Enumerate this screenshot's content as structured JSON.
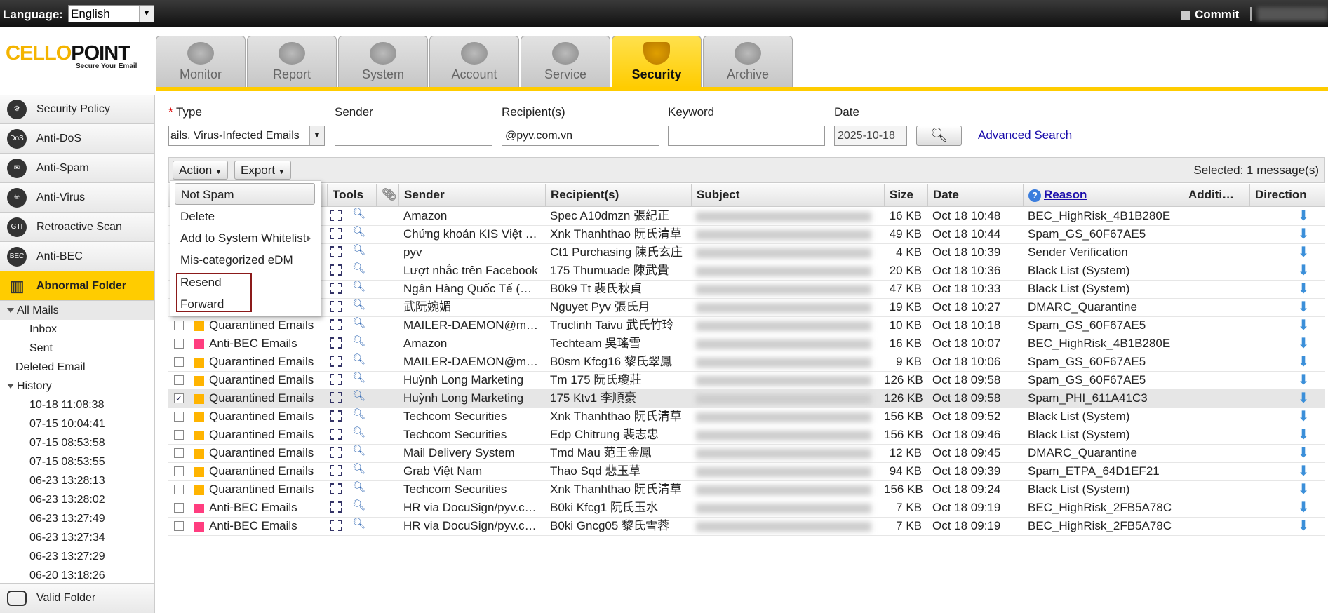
{
  "topbar": {
    "language_label": "Language:",
    "language_value": "English",
    "commit_label": "Commit"
  },
  "logo": {
    "brand_part1": "CELLO",
    "brand_part2": "POINT",
    "slogan": "Secure Your Email"
  },
  "tabs": [
    {
      "label": "Monitor",
      "icon": "monitor-icon"
    },
    {
      "label": "Report",
      "icon": "report-icon"
    },
    {
      "label": "System",
      "icon": "system-icon"
    },
    {
      "label": "Account",
      "icon": "account-icon"
    },
    {
      "label": "Service",
      "icon": "service-icon"
    },
    {
      "label": "Security",
      "icon": "shield-icon",
      "active": true
    },
    {
      "label": "Archive",
      "icon": "archive-icon"
    }
  ],
  "sidebar": {
    "items": [
      {
        "label": "Security Policy",
        "icon": "gear-icon"
      },
      {
        "label": "Anti-DoS",
        "icon": "dos-icon"
      },
      {
        "label": "Anti-Spam",
        "icon": "envelope-icon"
      },
      {
        "label": "Anti-Virus",
        "icon": "biohazard-icon"
      },
      {
        "label": "Retroactive Scan",
        "icon": "gti-icon"
      },
      {
        "label": "Anti-BEC",
        "icon": "bec-icon"
      },
      {
        "label": "Abnormal Folder",
        "icon": "folder-bars-icon",
        "active": true
      }
    ],
    "tree": {
      "all_mails": "All Mails",
      "inbox": "Inbox",
      "sent": "Sent",
      "deleted": "Deleted Email",
      "history": "History",
      "history_items": [
        "10-18 11:08:38",
        "07-15 10:04:41",
        "07-15 08:53:58",
        "07-15 08:53:55",
        "06-23 13:28:13",
        "06-23 13:28:02",
        "06-23 13:27:49",
        "06-23 13:27:34",
        "06-23 13:27:29",
        "06-20 13:18:26"
      ]
    },
    "valid_folder": "Valid Folder"
  },
  "search": {
    "type_label": "Type",
    "type_value": "ails, Virus-Infected Emails",
    "sender_label": "Sender",
    "sender_value": "",
    "recipient_label": "Recipient(s)",
    "recipient_value": "@pyv.com.vn",
    "keyword_label": "Keyword",
    "keyword_value": "",
    "date_label": "Date",
    "date_value": "2025-10-18",
    "advanced_search": "Advanced Search"
  },
  "toolbar": {
    "action_label": "Action",
    "export_label": "Export",
    "selected_text": "Selected: 1 message(s)"
  },
  "action_menu": {
    "items": [
      "Not Spam",
      "Delete",
      "Add to System Whitelist",
      "Mis-categorized eDM",
      "Resend",
      "Forward"
    ]
  },
  "columns": {
    "tools": "Tools",
    "sender": "Sender",
    "recipients": "Recipient(s)",
    "subject": "Subject",
    "size": "Size",
    "date": "Date",
    "reason": "Reason",
    "additional": "Additi…",
    "direction": "Direction"
  },
  "colors": {
    "quarantined": "#ffb400",
    "anti_bec": "#ff3d7f",
    "accent": "#ffcc00"
  },
  "rows": [
    {
      "type": "",
      "color": "",
      "sender": "Amazon",
      "recipient": "Spec A10dmzn 張紀正",
      "size": "16 KB",
      "date": "Oct 18 10:48",
      "reason": "BEC_HighRisk_4B1B280E",
      "checked": false
    },
    {
      "type": "",
      "color": "",
      "sender": "Chứng khoán KIS Việt …",
      "recipient": "Xnk Thanhthao 阮氏清草",
      "size": "49 KB",
      "date": "Oct 18 10:44",
      "reason": "Spam_GS_60F67AE5",
      "checked": false
    },
    {
      "type": "",
      "color": "",
      "sender": "pyv",
      "recipient": "Ct1 Purchasing 陳氏玄庄",
      "size": "4 KB",
      "date": "Oct 18 10:39",
      "reason": "Sender Verification",
      "checked": false
    },
    {
      "type": "",
      "color": "",
      "sender": "Lượt nhắc trên Facebook",
      "recipient": "175 Thumuade 陳武貴",
      "size": "20 KB",
      "date": "Oct 18 10:36",
      "reason": "Black List (System)",
      "checked": false
    },
    {
      "type": "",
      "color": "",
      "sender": "Ngân Hàng Quốc Tế (…",
      "recipient": "B0k9 Tt 裴氏秋貞",
      "size": "47 KB",
      "date": "Oct 18 10:33",
      "reason": "Black List (System)",
      "checked": false
    },
    {
      "type": "Quarantined Emails",
      "color": "#ffb400",
      "sender": "武阮婉媚",
      "recipient": "Nguyet Pyv 張氏月",
      "size": "19 KB",
      "date": "Oct 18 10:27",
      "reason": "DMARC_Quarantine",
      "checked": false
    },
    {
      "type": "Quarantined Emails",
      "color": "#ffb400",
      "sender": "MAILER-DAEMON@m…",
      "recipient": "Truclinh Taivu 武氏竹玲",
      "size": "10 KB",
      "date": "Oct 18 10:18",
      "reason": "Spam_GS_60F67AE5",
      "checked": false
    },
    {
      "type": "Anti-BEC Emails",
      "color": "#ff3d7f",
      "sender": "Amazon",
      "recipient": "Techteam 吳瑤雪",
      "size": "16 KB",
      "date": "Oct 18 10:07",
      "reason": "BEC_HighRisk_4B1B280E",
      "checked": false
    },
    {
      "type": "Quarantined Emails",
      "color": "#ffb400",
      "sender": "MAILER-DAEMON@m…",
      "recipient": "B0sm Kfcg16 黎氏翠鳳",
      "size": "9 KB",
      "date": "Oct 18 10:06",
      "reason": "Spam_GS_60F67AE5",
      "checked": false
    },
    {
      "type": "Quarantined Emails",
      "color": "#ffb400",
      "sender": "Huỳnh Long Marketing",
      "recipient": "Tm 175 阮氏瓊莊",
      "size": "126 KB",
      "date": "Oct 18 09:58",
      "reason": "Spam_GS_60F67AE5",
      "checked": false
    },
    {
      "type": "Quarantined Emails",
      "color": "#ffb400",
      "sender": "Huỳnh Long Marketing",
      "recipient": "175 Ktv1 李順豪",
      "size": "126 KB",
      "date": "Oct 18 09:58",
      "reason": "Spam_PHI_611A41C3",
      "checked": true
    },
    {
      "type": "Quarantined Emails",
      "color": "#ffb400",
      "sender": "Techcom Securities",
      "recipient": "Xnk Thanhthao 阮氏清草",
      "size": "156 KB",
      "date": "Oct 18 09:52",
      "reason": "Black List (System)",
      "checked": false
    },
    {
      "type": "Quarantined Emails",
      "color": "#ffb400",
      "sender": "Techcom Securities",
      "recipient": "Edp Chitrung 裴志忠",
      "size": "156 KB",
      "date": "Oct 18 09:46",
      "reason": "Black List (System)",
      "checked": false
    },
    {
      "type": "Quarantined Emails",
      "color": "#ffb400",
      "sender": "Mail Delivery System",
      "recipient": "Tmd Mau 范王金鳳",
      "size": "12 KB",
      "date": "Oct 18 09:45",
      "reason": "DMARC_Quarantine",
      "checked": false
    },
    {
      "type": "Quarantined Emails",
      "color": "#ffb400",
      "sender": "Grab Việt Nam",
      "recipient": "Thao Sqd 悲玉草",
      "size": "94 KB",
      "date": "Oct 18 09:39",
      "reason": "Spam_ETPA_64D1EF21",
      "checked": false
    },
    {
      "type": "Quarantined Emails",
      "color": "#ffb400",
      "sender": "Techcom Securities",
      "recipient": "Xnk Thanhthao 阮氏清草",
      "size": "156 KB",
      "date": "Oct 18 09:24",
      "reason": "Black List (System)",
      "checked": false
    },
    {
      "type": "Anti-BEC Emails",
      "color": "#ff3d7f",
      "sender": "HR via DocuSign/pyv.c…",
      "recipient": "B0ki Kfcg1 阮氏玉水",
      "size": "7 KB",
      "date": "Oct 18 09:19",
      "reason": "BEC_HighRisk_2FB5A78C",
      "checked": false
    },
    {
      "type": "Anti-BEC Emails",
      "color": "#ff3d7f",
      "sender": "HR via DocuSign/pyv.c…",
      "recipient": "B0ki Gncg05 黎氏雪蓉",
      "size": "7 KB",
      "date": "Oct 18 09:19",
      "reason": "BEC_HighRisk_2FB5A78C",
      "checked": false
    }
  ]
}
